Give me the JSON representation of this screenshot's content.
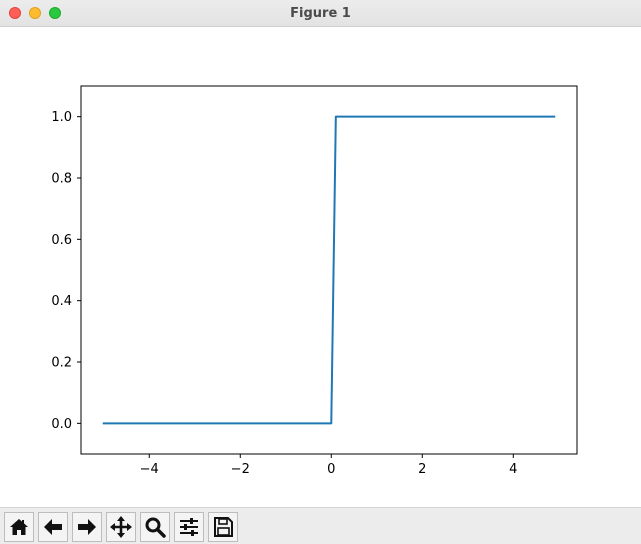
{
  "window": {
    "title": "Figure 1"
  },
  "toolbar": {
    "buttons": [
      {
        "icon": "home-icon"
      },
      {
        "icon": "back-arrow-icon"
      },
      {
        "icon": "forward-arrow-icon"
      },
      {
        "icon": "pan-move-icon"
      },
      {
        "icon": "zoom-magnifier-icon"
      },
      {
        "icon": "configure-subplots-icon"
      },
      {
        "icon": "save-disk-icon"
      }
    ]
  },
  "chart_data": {
    "type": "line",
    "title": "",
    "xlabel": "",
    "ylabel": "",
    "xlim": [
      -5.5,
      5.4
    ],
    "ylim": [
      -0.1,
      1.1
    ],
    "xticks": [
      -4,
      -2,
      0,
      2,
      4
    ],
    "xtick_labels": [
      "−4",
      "−2",
      "0",
      "2",
      "4"
    ],
    "yticks": [
      0.0,
      0.2,
      0.4,
      0.6,
      0.8,
      1.0
    ],
    "ytick_labels": [
      "0.0",
      "0.2",
      "0.4",
      "0.6",
      "0.8",
      "1.0"
    ],
    "grid": false,
    "series": [
      {
        "color": "#1f77b4",
        "x": [
          -5.0,
          0.0,
          0.1,
          4.9
        ],
        "y": [
          0.0,
          0.0,
          1.0,
          1.0
        ]
      }
    ]
  }
}
